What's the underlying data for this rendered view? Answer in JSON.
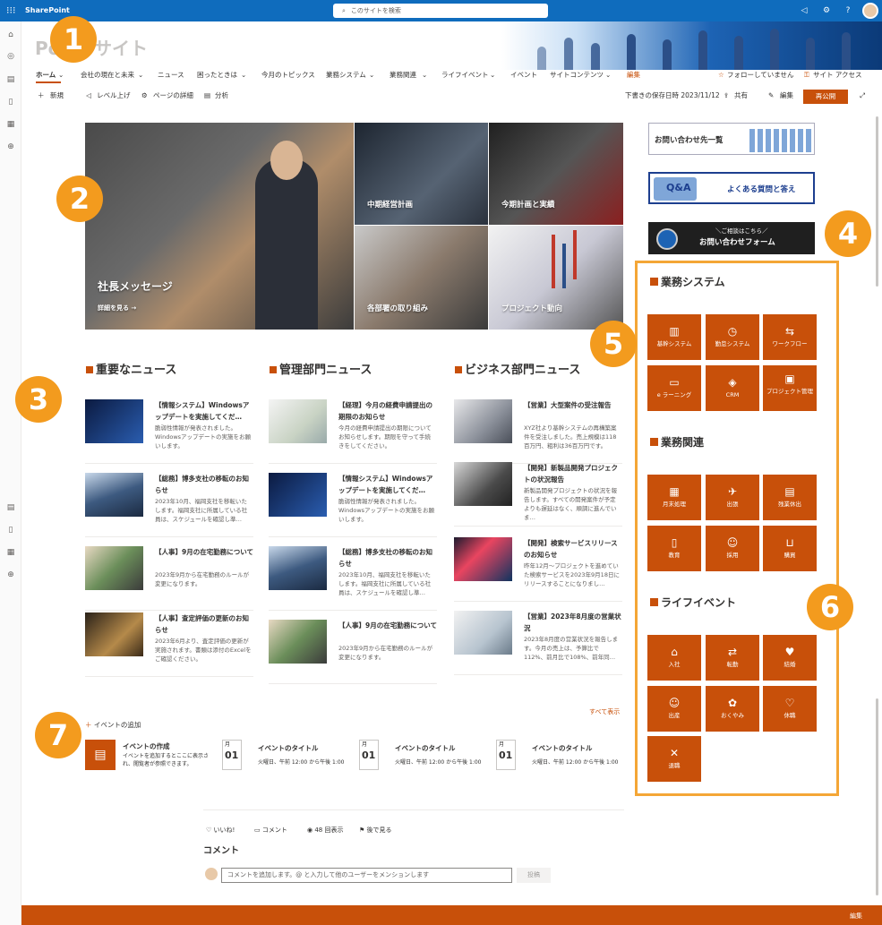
{
  "topbar": {
    "brand": "SharePoint",
    "search_placeholder": "このサイトを検索"
  },
  "site": {
    "title_visible": "Point サイト",
    "brand_color": "#c8500a",
    "accent_orange": "#f39b1e",
    "highlight_box": "#f4a636"
  },
  "nav": {
    "items": [
      "ホーム",
      "会社の現在と未来",
      "ニュース",
      "困ったときは",
      "今月のトピックス",
      "業務システム",
      "業務関連",
      "ライフイベント",
      "イベント",
      "サイトコンテンツ",
      "編集"
    ],
    "follow": "フォローしていません",
    "site_access": "サイト アクセス"
  },
  "cmdbar": {
    "new": "新規",
    "level_up": "レベル上げ",
    "page_details": "ページの詳細",
    "analytics": "分析",
    "draft": "下書きの保存日時 2023/11/12",
    "share": "共有",
    "edit": "編集",
    "republish": "再公開"
  },
  "hero": {
    "main_title": "社長メッセージ",
    "main_link": "詳細を見る →",
    "tiles": [
      "中期経営計画",
      "今期計画と実績",
      "各部署の取り組み",
      "プロジェクト動向"
    ]
  },
  "banners": {
    "inquiry_list": "お問い合わせ先一覧",
    "faq": "よくある質問と答え",
    "form_top": "＼ご相談はこちら／",
    "form": "お問い合わせフォーム",
    "qa": "Q&A"
  },
  "sections": {
    "business_systems": {
      "title": "業務システム",
      "items": [
        "基幹システム",
        "勤怠システム",
        "ワークフロー",
        "e ラーニング",
        "CRM",
        "プロジェクト管理"
      ]
    },
    "business_related": {
      "title": "業務関連",
      "items": [
        "月末処理",
        "出張",
        "残業休出",
        "教育",
        "採用",
        "購買"
      ]
    },
    "life_events": {
      "title": "ライフイベント",
      "items": [
        "入社",
        "転勤",
        "結婚",
        "出産",
        "おくやみ",
        "休職",
        "退職"
      ]
    }
  },
  "news_columns": [
    {
      "title": "重要なニュース",
      "items": [
        {
          "title": "【情報システム】Windowsアップデートを実施してくだ…",
          "desc": "脆弱性情報が発表されました。Windowsアップデートの実施をお願いします。"
        },
        {
          "title": "【総務】博多支社の移転のお知らせ",
          "desc": "2023年10月、福岡支社を移転いたします。福岡支社に所属している社員は、スケジュールを確認し準…"
        },
        {
          "title": "【人事】9月の在宅勤務について",
          "desc": "2023年9月から在宅勤務のルールが変更になります。"
        },
        {
          "title": "【人事】査定評価の更新のお知らせ",
          "desc": "2023年6月より、査定評価の更新が実施されます。書類は添付のExcelをご確認ください。"
        }
      ]
    },
    {
      "title": "管理部門ニュース",
      "items": [
        {
          "title": "【経理】今月の経費申請提出の期限のお知らせ",
          "desc": "今月の経費申請提出の期限について お知らせします。期限を守って手続きをしてください。"
        },
        {
          "title": "【情報システム】Windowsアップデートを実施してくだ…",
          "desc": "脆弱性情報が発表されました。Windowsアップデートの実施をお願いします。"
        },
        {
          "title": "【総務】博多支社の移転のお知らせ",
          "desc": "2023年10月、福岡支社を移転いたします。福岡支社に所属している社員は、スケジュールを確認し準…"
        },
        {
          "title": "【人事】9月の在宅勤務について",
          "desc": "2023年9月から在宅勤務のルールが変更になります。"
        }
      ]
    },
    {
      "title": "ビジネス部門ニュース",
      "items": [
        {
          "title": "【営業】大型案件の受注報告",
          "desc": "XYZ社より基幹システムの再構築案件を受注しました。売上規模は118百万円、粗利は36百万円です。"
        },
        {
          "title": "【開発】新製品開発プロジェクトの状況報告",
          "desc": "新製品開発プロジェクトの状況を報告します。すべての開発案件が予定よりも遅延はなく、順調に進んでいま…"
        },
        {
          "title": "【開発】検索サービスリリースのお知らせ",
          "desc": "昨年12月〜プロジェクトを進めていた検索サービスを2023年9月18日にリリースすることになりまし…"
        },
        {
          "title": "【営業】2023年8月度の営業状況",
          "desc": "2023年8月度の営業状況を報告します。今月の売上は、予算比で112%、前月比で108%、前年同…"
        }
      ]
    }
  ],
  "events": {
    "add": "イベントの追加",
    "show_all": "すべて表示",
    "create_title": "イベントの作成",
    "create_desc": "イベントを追加するとここに表示され、閲覧者が参照できます。",
    "cards": [
      {
        "month": "月",
        "day": "01",
        "title": "イベントのタイトル",
        "time": "火曜日、午前 12:00 から午後 1:00"
      },
      {
        "month": "月",
        "day": "01",
        "title": "イベントのタイトル",
        "time": "火曜日、午前 12:00 から午後 1:00"
      },
      {
        "month": "月",
        "day": "01",
        "title": "イベントのタイトル",
        "time": "火曜日、午前 12:00 から午後 1:00"
      }
    ]
  },
  "social": {
    "like": "いいね!",
    "comment": "コメント",
    "views": "48 回表示",
    "save": "後で見る",
    "comments_title": "コメント",
    "comment_placeholder": "コメントを追加します。@ と入力して他のユーザーをメンションします",
    "post": "投稿"
  },
  "footer": {
    "edit": "編集"
  },
  "callouts": [
    "1",
    "2",
    "3",
    "4",
    "5",
    "6",
    "7"
  ],
  "icons": [
    "waffle-icon",
    "search-icon",
    "megaphone-icon",
    "gear-icon",
    "help-icon",
    "home-icon",
    "globe-icon",
    "calendar-icon",
    "file-icon",
    "list-icon",
    "plus-icon"
  ]
}
